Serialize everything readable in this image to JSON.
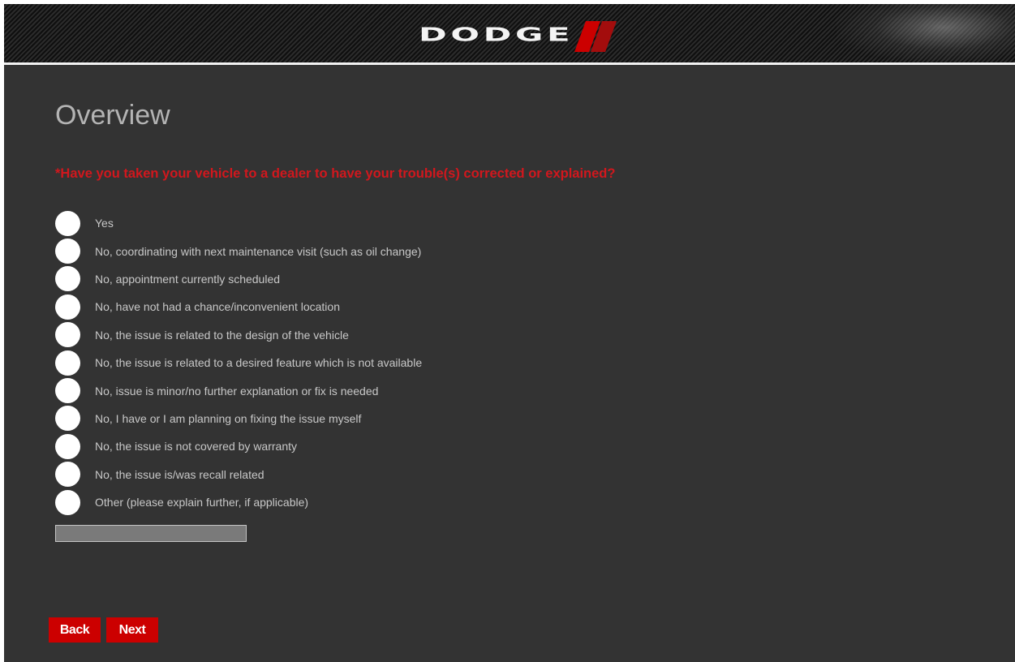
{
  "header": {
    "brand": "DODGE",
    "colors": {
      "stripe_red": "#cc0000",
      "stripe_dark_red": "#8a0a0a"
    }
  },
  "page": {
    "title": "Overview"
  },
  "question": {
    "required_marker": "*",
    "text": "Have you taken your vehicle to a dealer to have your trouble(s) corrected or explained?",
    "color": "#d2171d"
  },
  "options": [
    "Yes",
    "No, coordinating with next maintenance visit (such as oil change)",
    "No, appointment currently scheduled",
    "No, have not had a chance/inconvenient location",
    "No, the issue is related to the design of the vehicle",
    "No, the issue is related to a desired feature which is not available",
    "No, issue is minor/no further explanation or fix is needed",
    "No, I have or I am planning on fixing the issue myself",
    "No, the issue is not covered by warranty",
    "No, the issue is/was recall related",
    "Other (please explain further, if applicable)"
  ],
  "other_input": {
    "value": "",
    "placeholder": ""
  },
  "buttons": {
    "back": "Back",
    "next": "Next",
    "color": "#cc0000"
  }
}
